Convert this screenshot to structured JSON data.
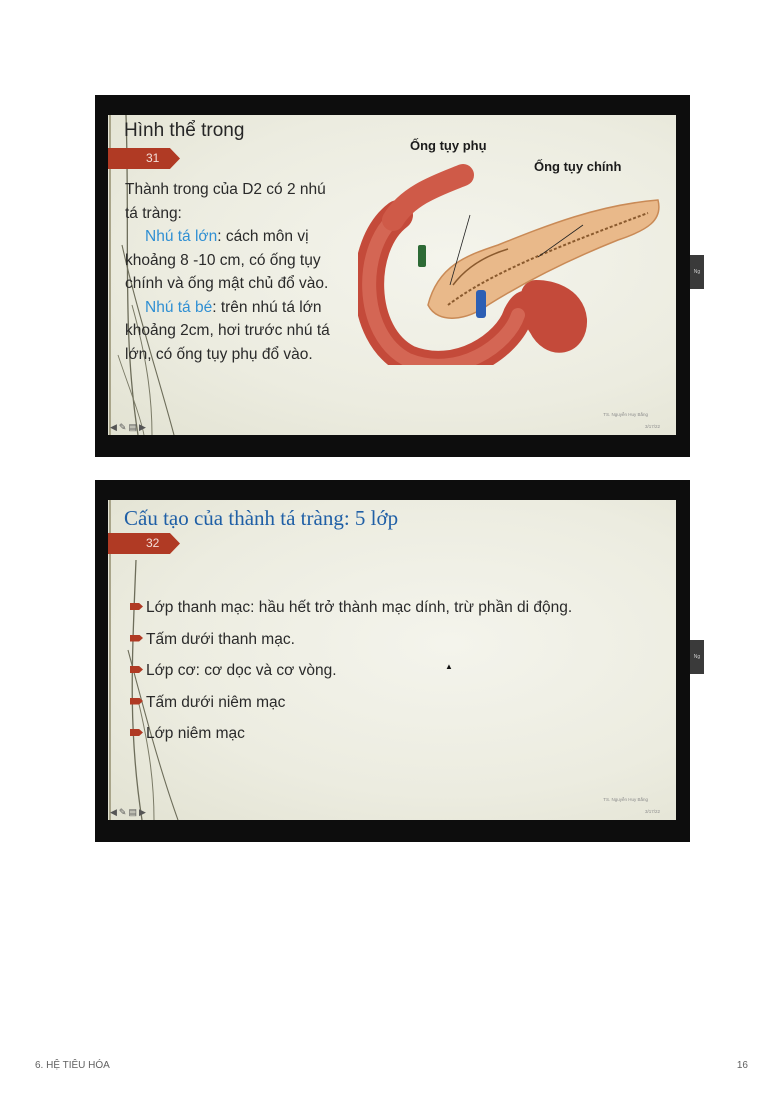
{
  "slide1": {
    "title": "Hình thể trong",
    "number": "31",
    "intro_line1": "Thành trong của D2 có 2 nhú",
    "intro_line2": "tá tràng:",
    "item1_term": "Nhú tá lớn",
    "item1_text_a": ": cách môn vị",
    "item1_text_b": "khoảng 8 -10 cm, có ống tụy",
    "item1_text_c": "chính và ống mật chủ đổ vào.",
    "item2_term": "Nhú tá bé",
    "item2_text_a": ": trên nhú tá lớn",
    "item2_text_b": "khoảng 2cm, hơi trước nhú tá",
    "item2_text_c": "lớn, có ống tụy phụ đổ vào.",
    "label_accessory_duct": "Ống tụy phụ",
    "label_main_duct": "Ống tụy chính",
    "footer_author": "TS. Nguyễn Huy Bằng",
    "footer_date": "3/17/22",
    "side_tab": "Ng"
  },
  "slide2": {
    "title": "Cấu tạo của thành tá tràng: 5 lớp",
    "number": "32",
    "bullets": [
      "Lớp thanh mạc: hầu hết trở thành mạc dính, trừ phần di động.",
      "Tấm dưới thanh mạc.",
      "Lớp cơ: cơ dọc và cơ vòng.",
      "Tấm dưới niêm mạc",
      "Lớp niêm mạc"
    ],
    "footer_author": "TS. Nguyễn Huy Bằng",
    "footer_date": "3/17/22",
    "side_tab": "Ng"
  },
  "page_footer": {
    "section": "6. HỆ TIÊU HÓA",
    "page_number": "16"
  },
  "icons": [
    "back-arrow-icon",
    "pen-icon",
    "slides-icon",
    "forward-arrow-icon",
    "mouse-cursor-icon"
  ],
  "colors": {
    "banner": "#b03a24",
    "highlight": "#2f8fd3",
    "title_blue": "#1f5fa6"
  }
}
